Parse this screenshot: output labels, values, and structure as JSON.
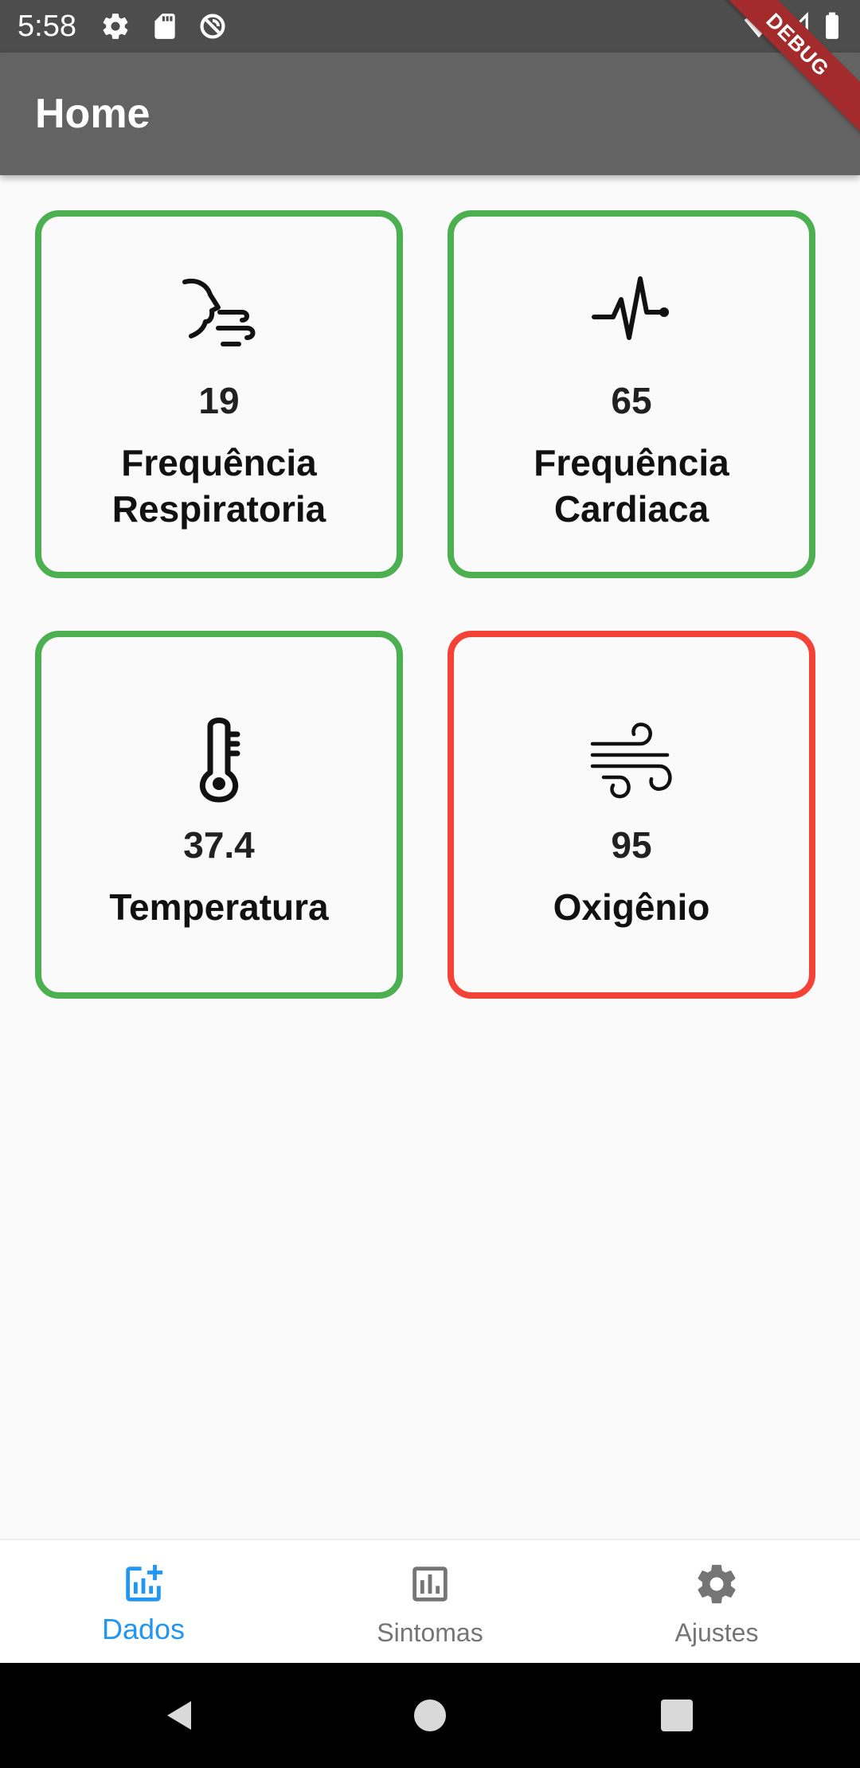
{
  "status_bar": {
    "time": "5:58",
    "icons": [
      "settings-icon",
      "sd-card-icon",
      "sync-icon",
      "wifi-icon",
      "signal-icon",
      "battery-icon"
    ]
  },
  "debug_banner": "DEBUG",
  "app_bar": {
    "title": "Home"
  },
  "cards": [
    {
      "icon": "breathing-icon",
      "value": "19",
      "label_line1": "Frequência",
      "label_line2": "Respiratoria",
      "status": "normal"
    },
    {
      "icon": "heartbeat-icon",
      "value": "65",
      "label_line1": "Frequência",
      "label_line2": "Cardiaca",
      "status": "normal"
    },
    {
      "icon": "thermometer-icon",
      "value": "37.4",
      "label": "Temperatura",
      "status": "normal"
    },
    {
      "icon": "wind-icon",
      "value": "95",
      "label": "Oxigênio",
      "status": "alert"
    }
  ],
  "colors": {
    "normal_border": "#4caf50",
    "alert_border": "#f44336",
    "active_nav": "#2196f3",
    "inactive_nav": "#757575",
    "app_bar": "#636363",
    "status_bar": "#4d4d4d"
  },
  "bottom_nav": {
    "items": [
      {
        "label": "Dados",
        "icon": "data-chart-icon",
        "active": true
      },
      {
        "label": "Sintomas",
        "icon": "symptoms-chart-icon",
        "active": false
      },
      {
        "label": "Ajustes",
        "icon": "settings-icon",
        "active": false
      }
    ]
  },
  "system_nav": [
    "back-icon",
    "home-icon",
    "recents-icon"
  ]
}
